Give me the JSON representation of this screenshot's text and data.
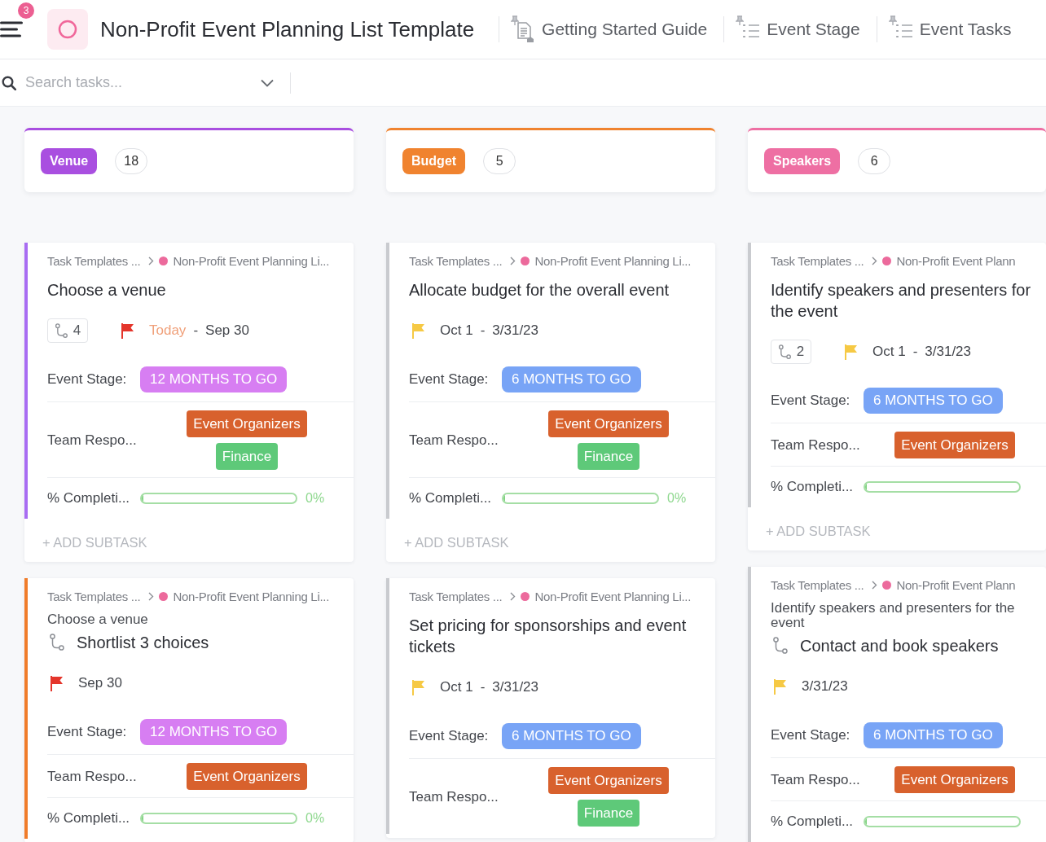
{
  "header": {
    "notifications": "3",
    "title": "Non-Profit Event Planning List Template"
  },
  "views": [
    {
      "label": "Getting Started Guide",
      "kind": "doc",
      "pinned": true
    },
    {
      "label": "Event Stage",
      "kind": "list",
      "pinned": true
    },
    {
      "label": "Event Tasks",
      "kind": "list",
      "pinned": true
    }
  ],
  "search": {
    "placeholder": "Search tasks..."
  },
  "columns": [
    {
      "name": "Venue",
      "color": "#a94fe0",
      "count": "18",
      "cards": [
        {
          "color": "#a86cf2",
          "breadcrumb": {
            "space": "Task Templates ...",
            "list": "Non-Profit Event Planning Li...",
            "color": "#ec6a9c"
          },
          "title": "Choose a venue",
          "subtasks": "4",
          "flag": {
            "color": "#e4352b"
          },
          "dates": {
            "start": "Today",
            "start_today": true,
            "separator": "-",
            "end": "Sep 30"
          },
          "fields": [
            {
              "kind": "stage",
              "label": "Event Stage:",
              "value": "12 MONTHS TO GO",
              "color": "#d77ef2"
            },
            {
              "kind": "team",
              "label": "Team Respo...",
              "tags": [
                {
                  "label": "Event Organizers",
                  "color": "#d8612d"
                },
                {
                  "label": "Finance",
                  "color": "#5ec979"
                }
              ]
            },
            {
              "kind": "progress",
              "label": "% Completi...",
              "level": 0,
              "reading": "0%"
            }
          ],
          "add_subtask": "+ ADD SUBTASK"
        },
        {
          "color": "#f07c2a",
          "breadcrumb": {
            "space": "Task Templates ...",
            "list": "Non-Profit Event Planning Li...",
            "color": "#ec6a9c"
          },
          "parent": "Choose a venue",
          "title": "Shortlist 3 choices",
          "flag": {
            "color": "#e4352b"
          },
          "dates": {
            "end": "Sep 30"
          },
          "fields": [
            {
              "kind": "stage",
              "label": "Event Stage:",
              "value": "12 MONTHS TO GO",
              "color": "#d77ef2"
            },
            {
              "kind": "team",
              "label": "Team Respo...",
              "tags": [
                {
                  "label": "Event Organizers",
                  "color": "#d8612d"
                }
              ]
            },
            {
              "kind": "progress",
              "label": "% Completi...",
              "level": 0,
              "reading": "0%"
            }
          ]
        }
      ]
    },
    {
      "name": "Budget",
      "color": "#f0832f",
      "count": "5",
      "cards": [
        {
          "color": "#c9cbcf",
          "breadcrumb": {
            "space": "Task Templates ...",
            "list": "Non-Profit Event Planning Li...",
            "color": "#ec6a9c"
          },
          "title": "Allocate budget for the overall event",
          "flag": {
            "color": "#f6c944"
          },
          "dates": {
            "start": "Oct 1",
            "start_today": false,
            "separator": "-",
            "end": "3/31/23"
          },
          "fields": [
            {
              "kind": "stage",
              "label": "Event Stage:",
              "value": "6 MONTHS TO GO",
              "color": "#78a4f6"
            },
            {
              "kind": "team",
              "label": "Team Respo...",
              "tags": [
                {
                  "label": "Event Organizers",
                  "color": "#d8612d"
                },
                {
                  "label": "Finance",
                  "color": "#5ec979"
                }
              ]
            },
            {
              "kind": "progress",
              "label": "% Completi...",
              "level": 0,
              "reading": "0%"
            }
          ],
          "add_subtask": "+ ADD SUBTASK"
        },
        {
          "color": "#c9cbcf",
          "breadcrumb": {
            "space": "Task Templates ...",
            "list": "Non-Profit Event Planning Li...",
            "color": "#ec6a9c"
          },
          "title": "Set pricing for sponsorships and event tickets",
          "flag": {
            "color": "#f6c944"
          },
          "dates": {
            "start": "Oct 1",
            "start_today": false,
            "separator": "-",
            "end": "3/31/23"
          },
          "fields": [
            {
              "kind": "stage",
              "label": "Event Stage:",
              "value": "6 MONTHS TO GO",
              "color": "#78a4f6"
            },
            {
              "kind": "team",
              "label": "Team Respo...",
              "tags": [
                {
                  "label": "Event Organizers",
                  "color": "#d8612d"
                },
                {
                  "label": "Finance",
                  "color": "#5ec979"
                }
              ]
            }
          ]
        }
      ]
    },
    {
      "name": "Speakers",
      "color": "#ee6fa3",
      "count": "6",
      "cards": [
        {
          "color": "#c9cbcf",
          "breadcrumb": {
            "space": "Task Templates ...",
            "list": "Non-Profit Event Plann",
            "color": "#ec6a9c"
          },
          "title": "Identify speakers and presenters for the event",
          "subtasks": "2",
          "flag": {
            "color": "#f6c944"
          },
          "dates": {
            "start": "Oct 1",
            "start_today": false,
            "separator": "-",
            "end": "3/31/23"
          },
          "fields": [
            {
              "kind": "stage",
              "label": "Event Stage:",
              "value": "6 MONTHS TO GO",
              "color": "#78a4f6"
            },
            {
              "kind": "team",
              "label": "Team Respo...",
              "tags": [
                {
                  "label": "Event Organizers",
                  "color": "#d8612d"
                }
              ]
            },
            {
              "kind": "progress",
              "label": "% Completi...",
              "level": 0
            }
          ],
          "add_subtask": "+ ADD SUBTASK"
        },
        {
          "color": "#c9cbcf",
          "breadcrumb": {
            "space": "Task Templates ...",
            "list": "Non-Profit Event Plann",
            "color": "#ec6a9c"
          },
          "parent": "Identify speakers and presenters for the event",
          "title": "Contact and book speakers",
          "flag": {
            "color": "#f6c944"
          },
          "dates": {
            "end": "3/31/23"
          },
          "fields": [
            {
              "kind": "stage",
              "label": "Event Stage:",
              "value": "6 MONTHS TO GO",
              "color": "#78a4f6"
            },
            {
              "kind": "team",
              "label": "Team Respo...",
              "tags": [
                {
                  "label": "Event Organizers",
                  "color": "#d8612d"
                }
              ]
            },
            {
              "kind": "progress",
              "label": "% Completi...",
              "level": 0
            }
          ]
        }
      ]
    }
  ]
}
